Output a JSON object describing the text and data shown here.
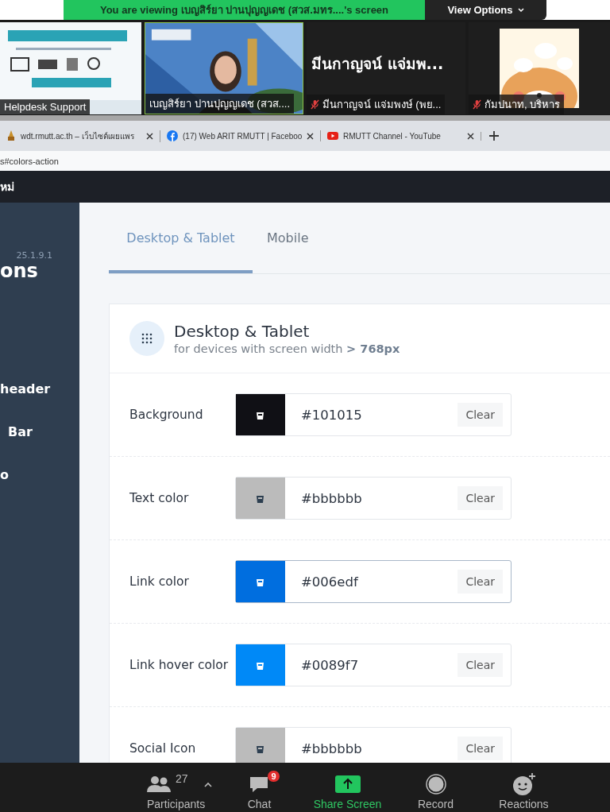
{
  "banner": {
    "text": "You  are  viewing เบญสิร์ยา ปานปุญญเดช (สวส.มทร....'s screen",
    "options_button": "View Options"
  },
  "video_tiles": [
    {
      "kind": "picture",
      "name": "Helpdesk Support",
      "muted": false
    },
    {
      "kind": "picture",
      "name": "เบญสิร์ยา ปานปุญญเดช (สวส....",
      "muted": false,
      "selected": true
    },
    {
      "kind": "name",
      "display": "มีนกาญจน์ แจ่มพ...",
      "name": "มีนกาญจน์ แจ่มพงษ์ (พย...",
      "muted": true
    },
    {
      "kind": "picture",
      "name": "กัมปนาท, บริหาร",
      "muted": true
    }
  ],
  "browser": {
    "tabs": [
      {
        "title": "wdt.rmutt.ac.th – เว็บไซต์เผยแพร",
        "kind": "site"
      },
      {
        "title": "(17) Web ARIT RMUTT | Faceboo",
        "kind": "facebook"
      },
      {
        "title": "RMUTT Channel - YouTube",
        "kind": "youtube"
      }
    ],
    "address": "s#colors-action"
  },
  "site_header": {
    "title": "หม่"
  },
  "sidebar": {
    "version": "25.1.9.1",
    "title": "ons",
    "items": [
      "header",
      "Bar",
      "o"
    ]
  },
  "tabs": [
    {
      "label": "Desktop & Tablet",
      "selected": true
    },
    {
      "label": "Mobile",
      "selected": false
    }
  ],
  "card": {
    "title": "Desktop & Tablet",
    "subtitle": "for devices with screen width **> 768px**",
    "rows": [
      {
        "label": "Background",
        "value": "#101015",
        "color": "#101015",
        "focused": false,
        "clear": "Clear"
      },
      {
        "label": "Text color",
        "value": "#bbbbbb",
        "color": "#bbbbbb",
        "focused": false,
        "clear": "Clear"
      },
      {
        "label": "Link color",
        "value": "#006edf",
        "color": "#006edf",
        "focused": true,
        "clear": "Clear"
      },
      {
        "label": "Link hover color",
        "value": "#0089f7",
        "color": "#0089f7",
        "focused": false,
        "clear": "Clear"
      },
      {
        "label": "Social Icon",
        "value": "#bbbbbb",
        "color": "#bbbbbb",
        "focused": false,
        "clear": "Clear"
      }
    ]
  },
  "toolbar": {
    "participants_count": "27",
    "items": [
      {
        "label": "Participants",
        "kind": "participants"
      },
      {
        "label": "Chat",
        "kind": "chat",
        "badge": "9"
      },
      {
        "label": "Share Screen",
        "kind": "share"
      },
      {
        "label": "Record",
        "kind": "record"
      },
      {
        "label": "Reactions",
        "kind": "reactions"
      }
    ]
  }
}
